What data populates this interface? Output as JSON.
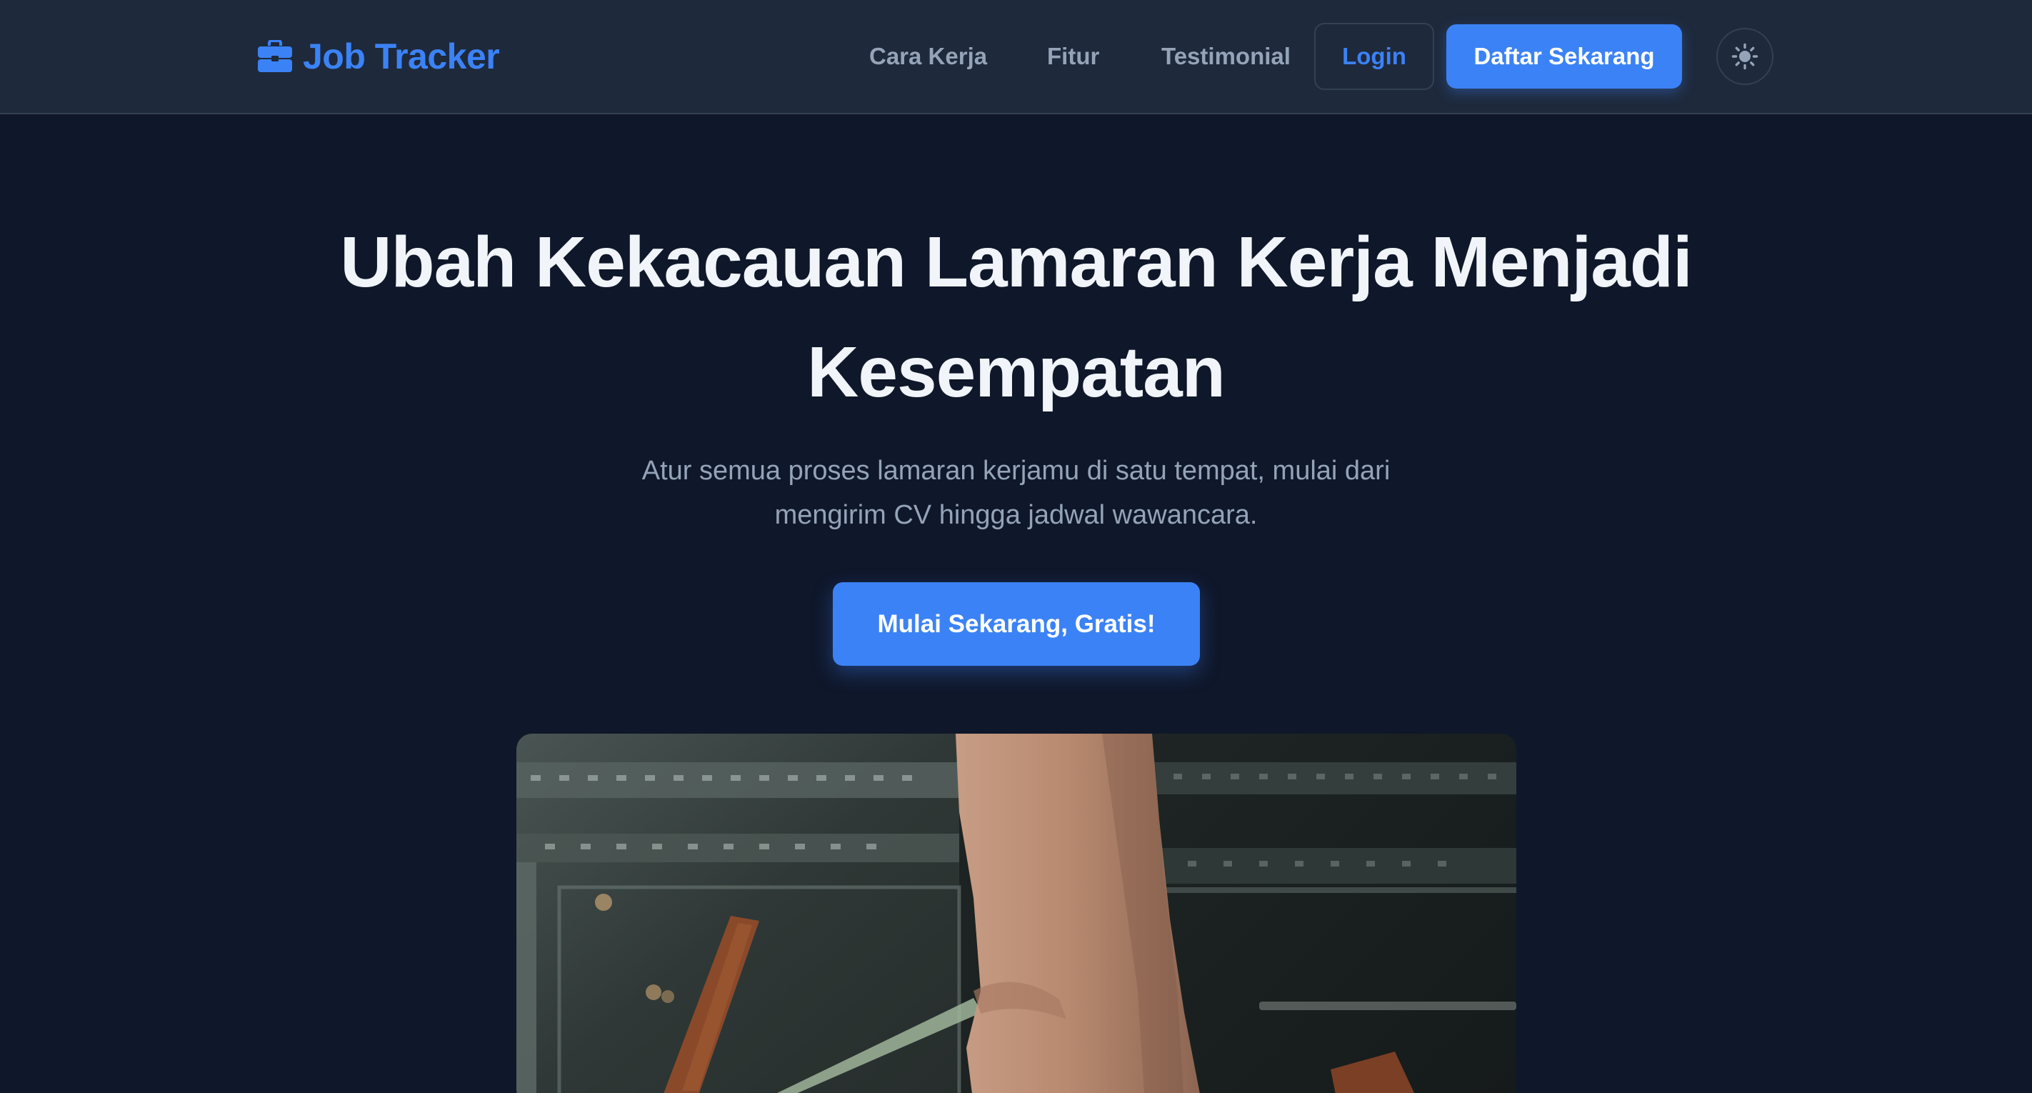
{
  "header": {
    "brand": "Job Tracker",
    "brand_icon": "briefcase-icon",
    "nav": [
      "Cara Kerja",
      "Fitur",
      "Testimonial"
    ],
    "login_label": "Login",
    "signup_label": "Daftar Sekarang",
    "theme_icon": "sun-icon"
  },
  "hero": {
    "title": "Ubah Kekacauan Lamaran Kerja Menjadi Kesempatan",
    "subtitle": "Atur semua proses lamaran kerjamu di satu tempat, mulai dari mengirim CV hingga jadwal wawancara.",
    "cta_label": "Mulai Sekarang, Gratis!",
    "image": "photo of a hand over a dark cutting mat with rulers and leather pieces"
  },
  "colors": {
    "background": "#0f172a",
    "header_bg": "#1e293b",
    "accent": "#3b82f6",
    "text": "#f1f5f9",
    "muted": "#94a3b8"
  }
}
